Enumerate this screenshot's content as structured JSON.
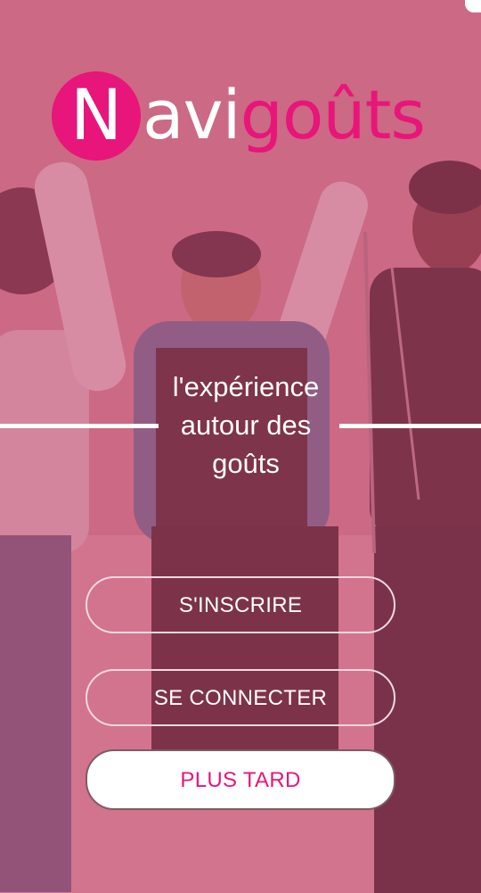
{
  "app": {
    "logo_letter": "N",
    "logo_part1": "avi",
    "logo_part2": "goûts"
  },
  "hero": {
    "tagline_line1": "l'expérience",
    "tagline_line2": "autour des",
    "tagline_line3": "goûts"
  },
  "actions": {
    "signup_label": "S'INSCRIRE",
    "login_label": "SE CONNECTER",
    "later_label": "PLUS TARD"
  },
  "colors": {
    "brand_pink": "#e8157a",
    "overlay_pink": "#ce4e76",
    "white": "#ffffff"
  },
  "icons": {
    "background": "group-jumping-photo"
  }
}
